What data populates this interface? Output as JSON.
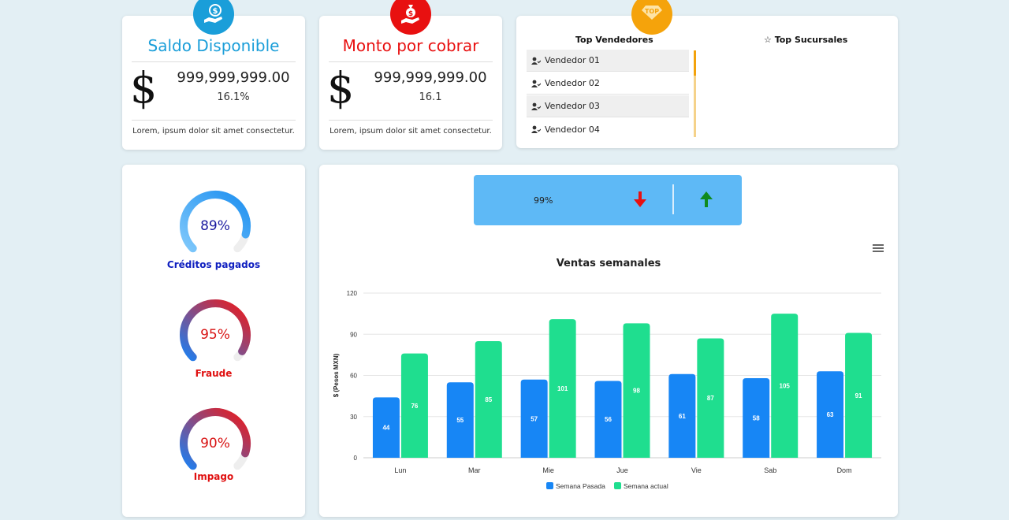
{
  "colors": {
    "background": "#e3eff4",
    "saldo_accent": "#1a9ed9",
    "monto_accent": "#e81010",
    "top_accent": "#f5a30b",
    "kpi_bg": "#5eb9f6",
    "down_arrow": "#e81010",
    "up_arrow": "#0f8a1e",
    "series_pasada": "#1786f5",
    "series_actual": "#1fde8f"
  },
  "saldo": {
    "icon": "money-hand-icon",
    "title": "Saldo Disponible",
    "currency_symbol": "$",
    "amount": "999,999,999.00",
    "percent": "16.1%",
    "note": "Lorem, ipsum dolor sit amet consectetur."
  },
  "monto": {
    "icon": "money-bag-hand-icon",
    "title": "Monto por cobrar",
    "currency_symbol": "$",
    "amount": "999,999,999.00",
    "percent": "16.1",
    "note": "Lorem, ipsum dolor sit amet consectetur."
  },
  "top": {
    "icon": "top-badge-icon",
    "badge_text": "TOP",
    "vendedores_title": "Top Vendedores",
    "sucursales_title": "Top Sucursales",
    "vendedores": [
      {
        "label": "Vendedor 01"
      },
      {
        "label": "Vendedor 02"
      },
      {
        "label": "Vendedor 03"
      },
      {
        "label": "Vendedor 04"
      }
    ]
  },
  "gauges": [
    {
      "value": "89%",
      "fraction": 0.89,
      "label": "Créditos pagados",
      "label_color": "#1020c0",
      "value_color": "#1a1aa0"
    },
    {
      "value": "95%",
      "fraction": 0.95,
      "label": "Fraude",
      "label_color": "#e01010",
      "value_color": "#d81414"
    },
    {
      "value": "90%",
      "fraction": 0.9,
      "label": "Impago",
      "label_color": "#e01010",
      "value_color": "#d81414"
    }
  ],
  "kpi": {
    "value": "99%",
    "down_icon": "arrow-down-icon",
    "up_icon": "arrow-up-icon"
  },
  "chart_data": {
    "type": "bar",
    "title": "Ventas semanales",
    "ylabel": "$ (Pesos MXN)",
    "xlabel": "",
    "categories": [
      "Lun",
      "Mar",
      "Mie",
      "Jue",
      "Vie",
      "Sab",
      "Dom"
    ],
    "ylim": [
      0,
      120
    ],
    "yticks": [
      0,
      30,
      60,
      90,
      120
    ],
    "grid": true,
    "legend_position": "bottom",
    "series": [
      {
        "name": "Semana Pasada",
        "values": [
          44,
          55,
          57,
          56,
          61,
          58,
          63
        ]
      },
      {
        "name": "Semana actual",
        "values": [
          76,
          85,
          101,
          98,
          87,
          105,
          91
        ]
      }
    ]
  }
}
